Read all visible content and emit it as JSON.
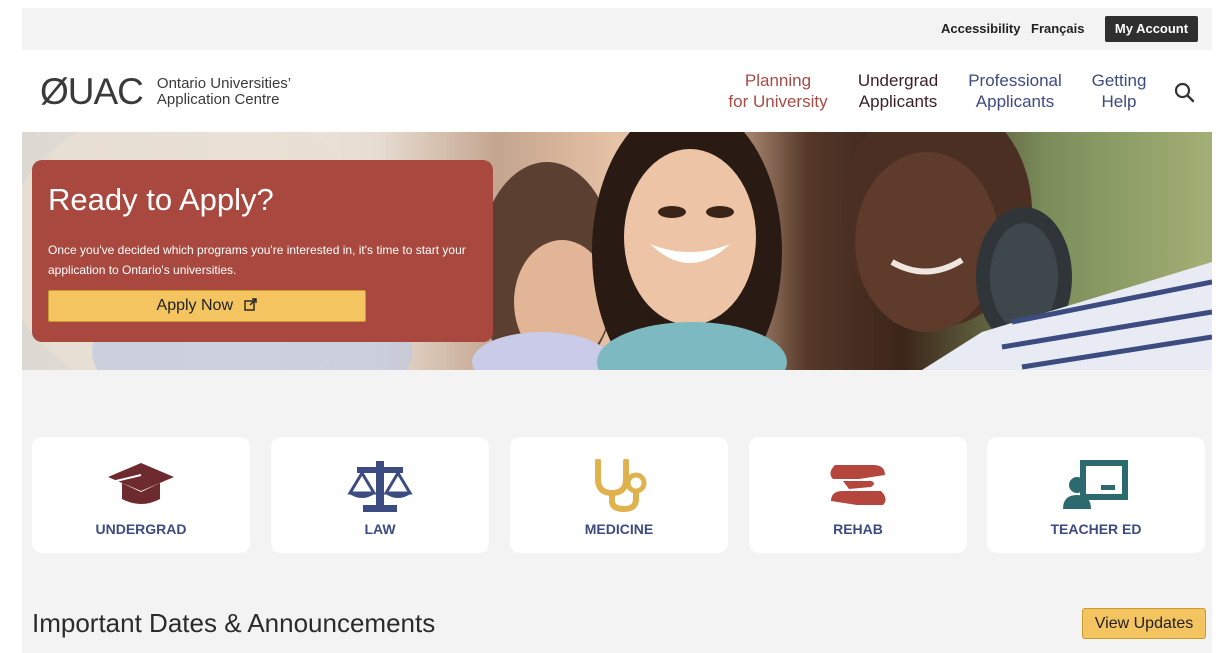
{
  "utility": {
    "accessibility": "Accessibility",
    "francais": "Français",
    "my_account": "My Account"
  },
  "header": {
    "logo_mark": "ØUAC",
    "logo_line1": "Ontario Universities’",
    "logo_line2": "Application Centre",
    "nav": [
      {
        "line1": "Planning",
        "line2": "for University"
      },
      {
        "line1": "Undergrad",
        "line2": "Applicants"
      },
      {
        "line1": "Professional",
        "line2": "Applicants"
      },
      {
        "line1": "Getting",
        "line2": "Help"
      }
    ],
    "search_icon": "search-icon"
  },
  "hero": {
    "title": "Ready to Apply?",
    "text": "Once you've decided which programs you're interested in, it's time to start your application to Ontario's universities.",
    "button": "Apply Now",
    "button_icon": "external-link-icon"
  },
  "tiles": [
    {
      "label": "UNDERGRAD",
      "icon": "graduation-cap-icon",
      "color": "#6e2b2f"
    },
    {
      "label": "LAW",
      "icon": "scales-icon",
      "color": "#3c4b80"
    },
    {
      "label": "MEDICINE",
      "icon": "stethoscope-icon",
      "color": "#e0b24e"
    },
    {
      "label": "REHAB",
      "icon": "helping-hands-icon",
      "color": "#b4463e"
    },
    {
      "label": "TEACHER ED",
      "icon": "teacher-board-icon",
      "color": "#2d6a70"
    }
  ],
  "announcements": {
    "title": "Important Dates & Announcements",
    "button": "View Updates"
  },
  "colors": {
    "hero_card": "#a8483f",
    "button_yellow": "#f3c45f",
    "nav_blue": "#3c4b80",
    "nav_red": "#a94b45"
  }
}
